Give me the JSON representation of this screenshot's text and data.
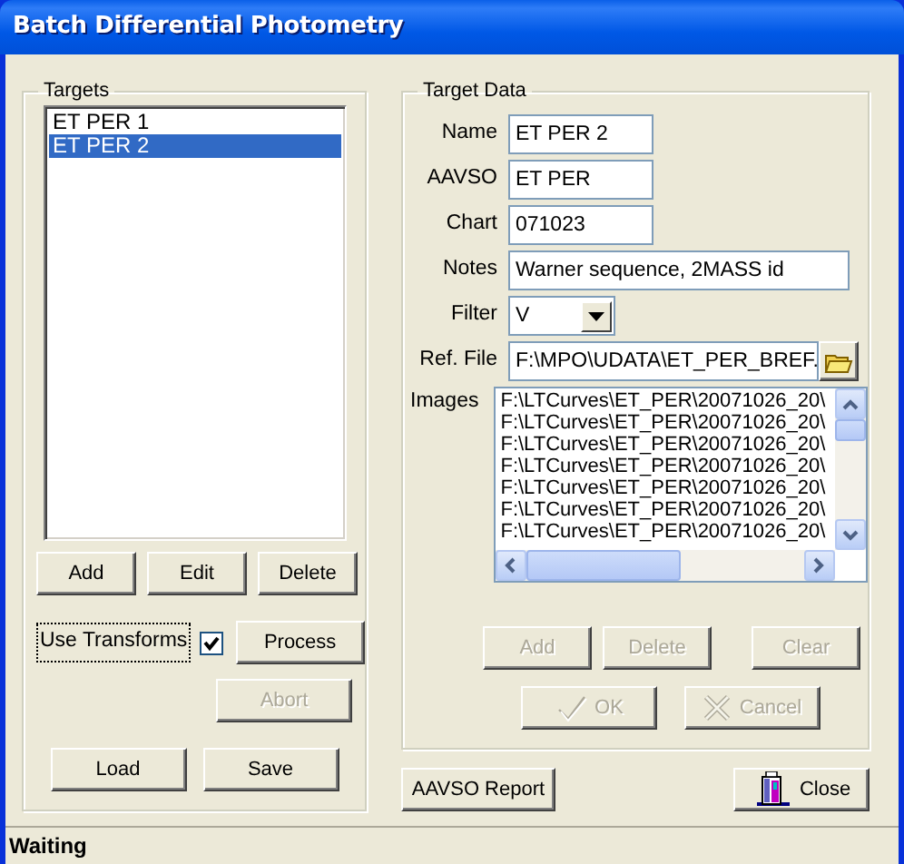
{
  "window": {
    "title": "Batch Differential Photometry"
  },
  "targets": {
    "label": "Targets",
    "items": [
      {
        "label": "ET PER 1",
        "selected": false
      },
      {
        "label": "ET PER 2",
        "selected": true
      }
    ],
    "buttons": [
      {
        "label": "Add",
        "disabled": false
      },
      {
        "label": "Edit",
        "disabled": false
      },
      {
        "label": "Delete",
        "disabled": false
      }
    ],
    "use_transforms": {
      "label": "Use Transforms",
      "checked": true,
      "focused": true
    },
    "process_button": {
      "label": "Process",
      "disabled": false
    },
    "abort_button": {
      "label": "Abort",
      "disabled": true
    },
    "file_buttons": [
      {
        "label": "Load",
        "disabled": false
      },
      {
        "label": "Save",
        "disabled": false
      }
    ]
  },
  "target_data": {
    "label": "Target Data",
    "fields": [
      {
        "label": "Name",
        "value": "ET PER 2",
        "kind": "short"
      },
      {
        "label": "AAVSO",
        "value": "ET PER",
        "kind": "short"
      },
      {
        "label": "Chart",
        "value": "071023",
        "kind": "short"
      },
      {
        "label": "Notes",
        "value": "Warner sequence, 2MASS id",
        "kind": "long"
      }
    ],
    "filter": {
      "label": "Filter",
      "value": "V"
    },
    "ref_file": {
      "label": "Ref. File",
      "value": "F:\\MPO\\UDATA\\ET_PER_BREF."
    },
    "images": {
      "label": "Images",
      "items": [
        "F:\\LTCurves\\ET_PER\\20071026_20\\",
        "F:\\LTCurves\\ET_PER\\20071026_20\\",
        "F:\\LTCurves\\ET_PER\\20071026_20\\",
        "F:\\LTCurves\\ET_PER\\20071026_20\\",
        "F:\\LTCurves\\ET_PER\\20071026_20\\",
        "F:\\LTCurves\\ET_PER\\20071026_20\\",
        "F:\\LTCurves\\ET_PER\\20071026_20\\"
      ]
    },
    "list_buttons": [
      {
        "label": "Add",
        "disabled": true
      },
      {
        "label": "Delete",
        "disabled": true
      },
      {
        "label": "Clear",
        "disabled": true
      }
    ],
    "confirm_buttons": [
      {
        "label": "OK",
        "kind": "check",
        "disabled": true
      },
      {
        "label": "Cancel",
        "kind": "cross",
        "disabled": true
      }
    ]
  },
  "footer_buttons": [
    {
      "label": "AAVSO Report",
      "kind": "plain",
      "disabled": false
    },
    {
      "label": "Close",
      "kind": "door",
      "disabled": false
    }
  ],
  "status_bar": {
    "text": "Waiting"
  }
}
